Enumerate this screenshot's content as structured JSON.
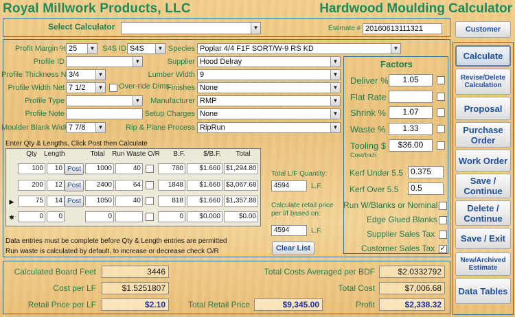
{
  "header": {
    "company": "Royal Millwork Products, LLC",
    "app_title": "Hardwood Moulding Calculator"
  },
  "select_calculator": {
    "label": "Select Calculator",
    "value": "",
    "estimate_label": "Estimate #",
    "estimate_value": "20160613111321"
  },
  "side_buttons": {
    "customer": "Customer",
    "calculate": "Calculate",
    "revise_delete": "Revise/Delete Calculation",
    "proposal": "Proposal",
    "purchase_order": "Purchase Order",
    "work_order": "Work Order",
    "save_continue": "Save / Continue",
    "delete_continue": "Delete / Continue",
    "save_exit": "Save / Exit",
    "new_archived": "New/Archived Estimate",
    "data_tables": "Data Tables"
  },
  "form": {
    "profit_margin_label": "Profit Margin %",
    "profit_margin_value": "25",
    "s4s_label": "S4S ID",
    "s4s_value": "S4S",
    "species_label": "Species",
    "species_value": "Poplar 4/4 F1F SORT/W-9 RS KD",
    "profile_id_label": "Profile ID",
    "profile_id_value": "",
    "supplier_label": "Supplier",
    "supplier_value": "Hood Delray",
    "thickness_label": "Profile Thickness Net",
    "thickness_value": "3/4",
    "lumber_width_label": "Lumber Width",
    "lumber_width_value": "9",
    "width_label": "Profile Width Net",
    "width_value": "7 1/2",
    "override_label": "Over-ride Dims",
    "finishes_label": "Finishes",
    "finishes_value": "None",
    "profile_type_label": "Profile Type",
    "profile_type_value": "",
    "manufacturer_label": "Manufacturer",
    "manufacturer_value": "RMP",
    "profile_note_label": "Profile Note",
    "profile_note_value": "",
    "setup_label": "Setup Charges",
    "setup_value": "None",
    "blank_width_label": "Moulder Blank Width",
    "blank_width_value": "7 7/8",
    "rip_plane_label": "Rip & Plane Process",
    "rip_plane_value": "RipRun"
  },
  "factors": {
    "title": "Factors",
    "deliver_label": "Deliver %",
    "deliver_value": "1.05",
    "flat_rate_label": "Flat Rate",
    "flat_rate_value": "",
    "shrink_label": "Shrink %",
    "shrink_value": "1.07",
    "waste_label": "Waste %",
    "waste_value": "1.33",
    "tooling_label": "Tooling $",
    "tooling_sub": "Cost/Inch",
    "tooling_value": "$36.00",
    "kerf_under_label": "Kerf Under 5.5",
    "kerf_under_value": "0.375",
    "kerf_over_label": "Kerf Over 5.5",
    "kerf_over_value": "0.5",
    "run_blanks_label": "Run W/Blanks or Nominal",
    "edge_glued_label": "Edge Glued Blanks",
    "supplier_tax_label": "Supplier Sales Tax",
    "customer_tax_label": "Customer Sales Tax",
    "customer_tax_checked": "✓"
  },
  "grid": {
    "instruction": "Enter Qty & Lengths, Click Post then Calculate",
    "headers": [
      "Qty",
      "Length",
      "Total",
      "Run Waste O/R",
      "B.F.",
      "$/B.F.",
      "Total"
    ],
    "post_label": "Post",
    "rows": [
      {
        "marker": "",
        "qty": "100",
        "length": "10",
        "total": "1000",
        "waste": "40",
        "bf": "780",
        "rate": "$1.660",
        "total_cost": "$1,294.80"
      },
      {
        "marker": "",
        "qty": "200",
        "length": "12",
        "total": "2400",
        "waste": "64",
        "bf": "1848",
        "rate": "$1.660",
        "total_cost": "$3,067.68"
      },
      {
        "marker": "▶",
        "qty": "75",
        "length": "14",
        "total": "1050",
        "waste": "40",
        "bf": "818",
        "rate": "$1.660",
        "total_cost": "$1,357.88"
      },
      {
        "marker": "✱",
        "qty": "0",
        "length": "0",
        "total": "0",
        "waste": "",
        "bf": "0",
        "rate": "$0.000",
        "total_cost": "$0.00"
      }
    ],
    "note1": "Data entries must be complete before Qty & Length entries are permitted",
    "note2": "Run waste is calculated by default, to increase or decrease check O/R"
  },
  "lf_panel": {
    "total_lf_label": "Total L/F Quantity:",
    "total_lf_value": "4594",
    "lf_unit": "L.F.",
    "retail_label": "Calculate retail price per l/f based on:",
    "retail_value": "4594",
    "clear_list": "Clear List"
  },
  "summary": {
    "board_feet_label": "Calculated Board Feet",
    "board_feet_value": "3446",
    "cost_lf_label": "Cost per LF",
    "cost_lf_value": "$1.5251807",
    "retail_lf_label": "Retail Price per LF",
    "retail_lf_value": "$2.10",
    "total_retail_label": "Total Retail Price",
    "total_retail_value": "$9,345.00",
    "avg_bdf_label": "Total Costs Averaged per BDF",
    "avg_bdf_value": "$2.0332792",
    "total_cost_label": "Total Cost",
    "total_cost_value": "$7,006.68",
    "profit_label": "Profit",
    "profit_value": "$2,338.32"
  }
}
